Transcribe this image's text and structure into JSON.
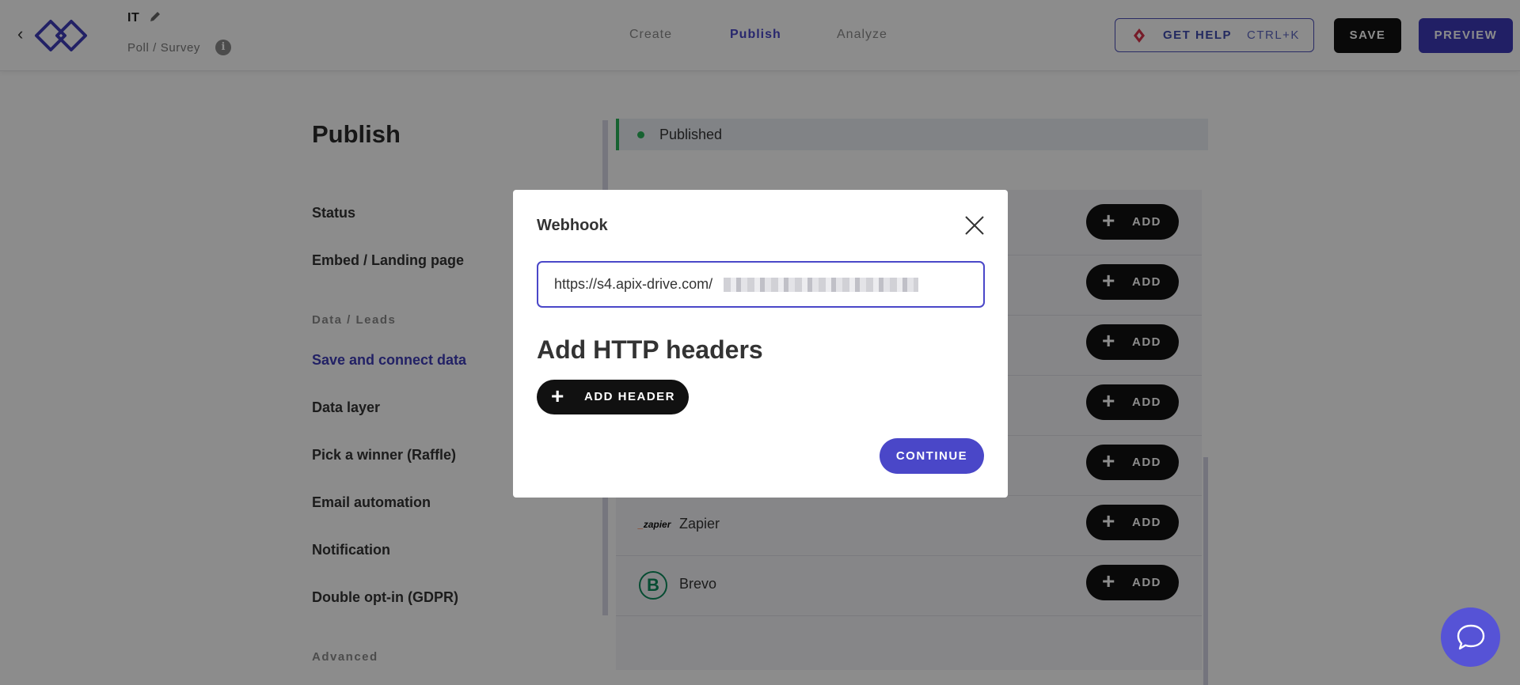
{
  "header": {
    "project_title": "IT",
    "project_type": "Poll / Survey",
    "tabs": [
      {
        "label": "Create"
      },
      {
        "label": "Publish"
      },
      {
        "label": "Analyze"
      }
    ],
    "help_label": "GET HELP",
    "help_shortcut": "CTRL+K",
    "save_label": "SAVE",
    "preview_label": "PREVIEW"
  },
  "sidebar": {
    "page_title": "Publish",
    "items": [
      {
        "label": "Status"
      },
      {
        "label": "Embed / Landing page"
      },
      {
        "label": "Data / Leads"
      },
      {
        "label": "Save and connect data"
      },
      {
        "label": "Data layer"
      },
      {
        "label": "Pick a winner (Raffle)"
      },
      {
        "label": "Email automation"
      },
      {
        "label": "Notification"
      },
      {
        "label": "Double opt-in (GDPR)"
      },
      {
        "label": "Advanced"
      }
    ]
  },
  "status": {
    "text": "Published"
  },
  "integrations": {
    "add_label": "ADD",
    "rows": [
      {
        "name": ""
      },
      {
        "name": ""
      },
      {
        "name": ""
      },
      {
        "name": ""
      },
      {
        "name": ""
      },
      {
        "name": "Zapier"
      },
      {
        "name": "Brevo"
      }
    ],
    "zapier_logo": "zapier",
    "brevo_logo": "B"
  },
  "modal": {
    "title": "Webhook",
    "url_value": "https://s4.apix-drive.com/",
    "headers_title": "Add HTTP headers",
    "add_header_label": "ADD HEADER",
    "continue_label": "CONTINUE"
  },
  "colors": {
    "accent": "#4a47c8",
    "published_green": "#2ab25a",
    "preview": "#3d3ab8"
  }
}
